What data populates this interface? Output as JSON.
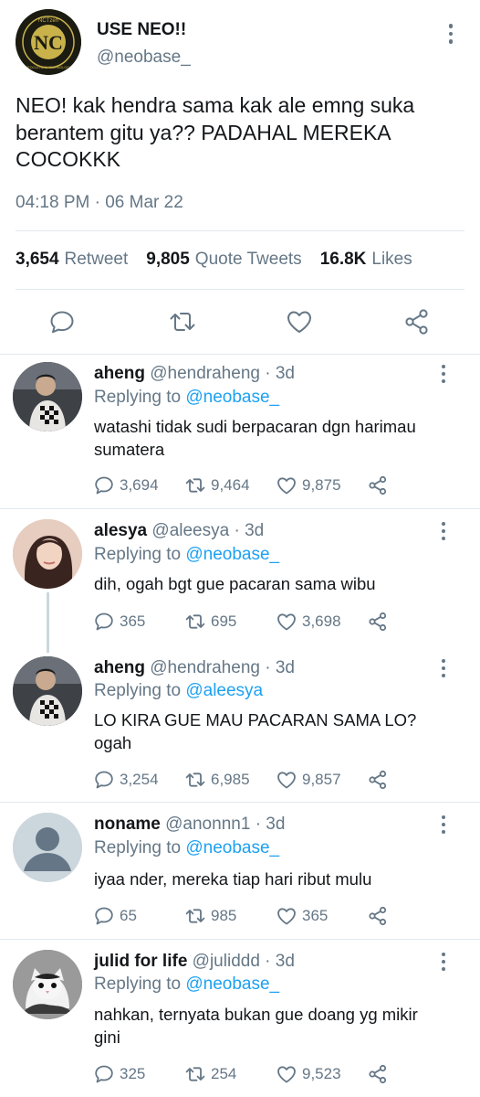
{
  "main_tweet": {
    "display_name": "USE NEO!!",
    "handle": "@neobase_",
    "text": "NEO! kak hendra sama kak ale emng suka berantem gitu ya?? PADAHAL MEREKA COCOKKK",
    "timestamp": "04:18 PM · 06 Mar 22",
    "stats": {
      "retweet_count": "3,654",
      "retweet_label": "Retweet",
      "quote_count": "9,805",
      "quote_label": "Quote Tweets",
      "likes_count": "16.8K",
      "likes_label": "Likes"
    },
    "avatar_text": {
      "top": "NCTzen",
      "bottom": "NEOCULTURE TECHNOLOGY"
    }
  },
  "replies": [
    {
      "name": "aheng",
      "handle": "@hendraheng",
      "time": "· 3d",
      "replying_label": "Replying to",
      "replying_to": "@neobase_",
      "text": "watashi tidak sudi berpacaran dgn harimau sumatera",
      "replies": "3,694",
      "retweets": "9,464",
      "likes": "9,875"
    },
    {
      "name": "alesya",
      "handle": "@aleesya",
      "time": "· 3d",
      "replying_label": "Replying to",
      "replying_to": "@neobase_",
      "text": "dih, ogah bgt gue pacaran sama wibu",
      "replies": "365",
      "retweets": "695",
      "likes": "3,698"
    },
    {
      "name": "aheng",
      "handle": "@hendraheng",
      "time": "· 3d",
      "replying_label": "Replying to",
      "replying_to": "@aleesya",
      "text": "LO KIRA GUE MAU PACARAN SAMA LO? ogah",
      "replies": "3,254",
      "retweets": "6,985",
      "likes": "9,857"
    },
    {
      "name": "noname",
      "handle": "@anonnn1",
      "time": "· 3d",
      "replying_label": "Replying to",
      "replying_to": "@neobase_",
      "text": "iyaa nder, mereka tiap hari ribut mulu",
      "replies": "65",
      "retweets": "985",
      "likes": "365"
    },
    {
      "name": "julid for life",
      "handle": "@juliddd",
      "time": "· 3d",
      "replying_label": "Replying to",
      "replying_to": "@neobase_",
      "text": "nahkan, ternyata bukan gue doang yg mikir gini",
      "replies": "325",
      "retweets": "254",
      "likes": "9,523"
    }
  ],
  "colors": {
    "text": "#14171a",
    "secondary": "#657786",
    "link": "#1da1f2",
    "divider": "#e1e8ed",
    "avatar_gold": "#c9b24a",
    "avatar_dark": "#1b1b12"
  },
  "icons": [
    "reply-icon",
    "retweet-icon",
    "like-icon",
    "share-icon",
    "more-options-icon",
    "default-avatar-icon"
  ]
}
